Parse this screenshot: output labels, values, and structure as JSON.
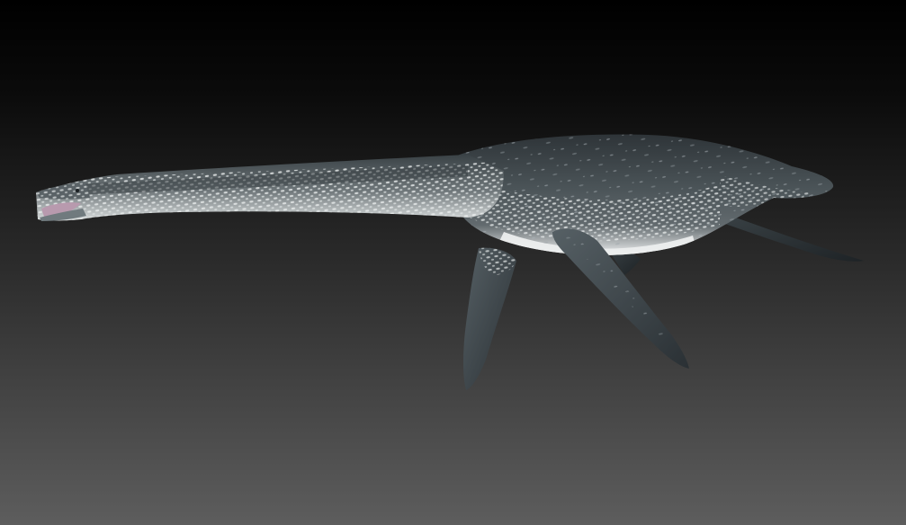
{
  "scene": {
    "subject": "plesiosaur-3d-model",
    "background": {
      "type": "vertical-gradient",
      "top_color": "#000000",
      "bottom_color": "#5d5d5d"
    },
    "colors": {
      "skin_dark": "#3c4347",
      "skin_mid": "#50585c",
      "belly_light": "#e6e8e8",
      "spot_light": "#c9cfd1",
      "mouth_pink": "#b89aae",
      "outline": "#1c2124"
    }
  }
}
